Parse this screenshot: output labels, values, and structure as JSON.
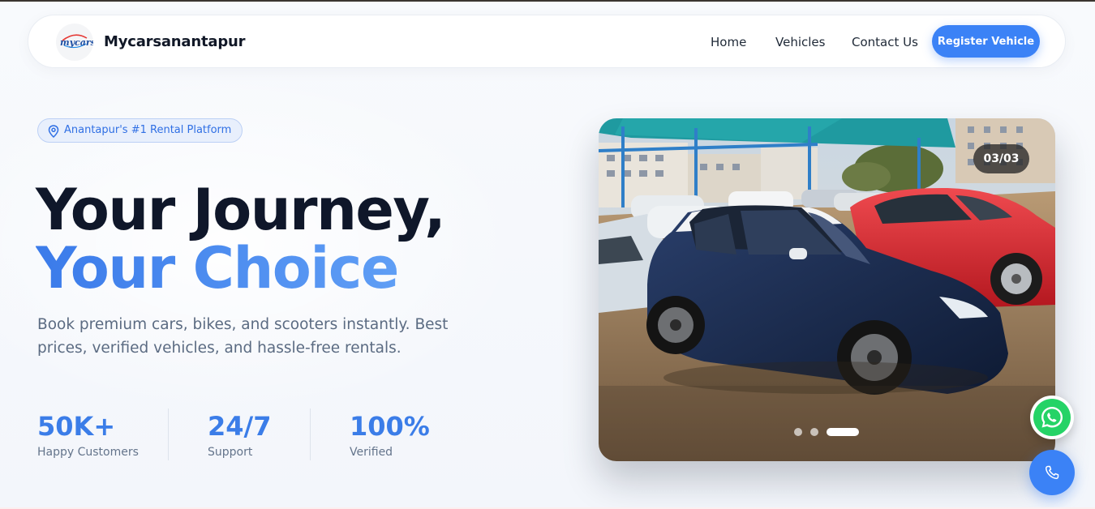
{
  "nav": {
    "brand": "Mycarsanantapur",
    "logo_text": "mycars",
    "links": [
      "Home",
      "Vehicles",
      "Contact Us"
    ],
    "cta": "Register Vehicle"
  },
  "hero": {
    "badge": "Anantapur's #1 Rental Platform",
    "badge_icon": "map-pin-icon",
    "title_line1": "Your Journey,",
    "title_line2": "Your Choice",
    "subtitle": "Book premium cars, bikes, and scooters instantly. Best prices, verified vehicles, and hassle-free rentals.",
    "stats": [
      {
        "value": "50K+",
        "label": "Happy Customers"
      },
      {
        "value": "24/7",
        "label": "Support"
      },
      {
        "value": "100%",
        "label": "Verified"
      }
    ]
  },
  "carousel": {
    "counter": "03/03",
    "total_slides": 3,
    "active_slide": 3
  },
  "floating": {
    "whatsapp_icon": "whatsapp-icon",
    "call_icon": "phone-icon"
  },
  "colors": {
    "accent": "#3b82f6",
    "heading": "#0f172a",
    "body_text": "#5b6b82",
    "whatsapp": "#25d366"
  }
}
